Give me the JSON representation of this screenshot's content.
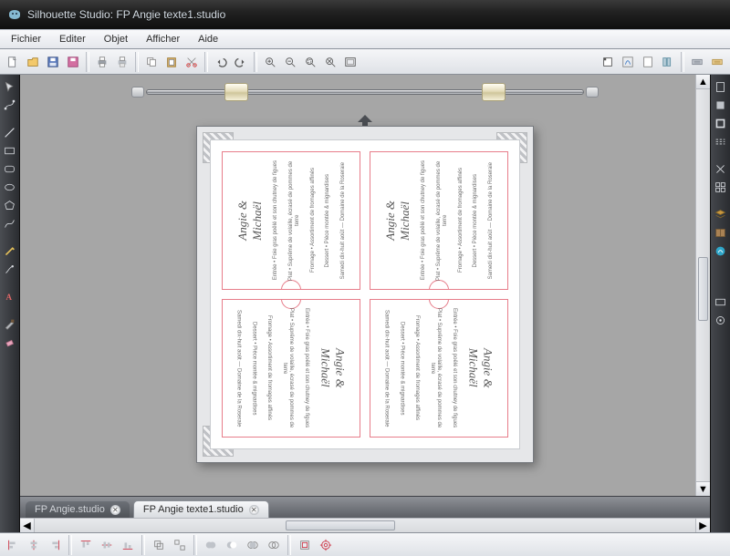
{
  "window": {
    "app_name": "Silhouette Studio",
    "file_name": "FP Angie texte1.studio",
    "title": "Silhouette Studio: FP Angie texte1.studio"
  },
  "menu": {
    "items": [
      "Fichier",
      "Editer",
      "Objet",
      "Afficher",
      "Aide"
    ]
  },
  "toolbar_top": {
    "left_group": [
      "new",
      "open",
      "save",
      "save-lib",
      "print",
      "print-queue"
    ],
    "edit_group": [
      "copy",
      "paste",
      "cut",
      "undo",
      "redo"
    ],
    "zoom_group": [
      "zoom-in",
      "zoom-out",
      "zoom-select",
      "zoom-drag",
      "fit-page"
    ],
    "right_group": [
      "registration",
      "grid",
      "page-setup",
      "cut-lib",
      "send-to-silhouette",
      "cut-settings"
    ]
  },
  "left_tools": [
    "select",
    "edit-points",
    "line",
    "rect",
    "round-rect",
    "ellipse",
    "polygon",
    "curve",
    "freehand",
    "smooth-freehand",
    "eraser",
    "text",
    "knife",
    "eyedropper"
  ],
  "right_tools": [
    "page-tools",
    "fill-color",
    "line-color",
    "line-style",
    "cut-style",
    "registration-marks",
    "layers",
    "library",
    "store"
  ],
  "documents": {
    "tabs": [
      {
        "label": "FP Angie.studio",
        "active": false
      },
      {
        "label": "FP Angie texte1.studio",
        "active": true
      }
    ]
  },
  "canvas_card": {
    "script_title": "Angie &\nMichaël",
    "line1": "Entrée • Foie gras poêlé et son chutney de figues",
    "line2": "Plat • Suprême de volaille, écrasé de pommes de terre",
    "line3": "Fromage • Assortiment de fromages affinés",
    "line4": "Dessert • Pièce montée & mignardises",
    "line5": "Samedi dix-huit août — Domaine de la Roseraie"
  },
  "bottom_tools": [
    "align-left",
    "align-center-h",
    "align-right",
    "align-top",
    "align-center-v",
    "align-bottom",
    "group",
    "ungroup",
    "weld",
    "subtract",
    "intersect",
    "crop",
    "offset",
    "target"
  ]
}
